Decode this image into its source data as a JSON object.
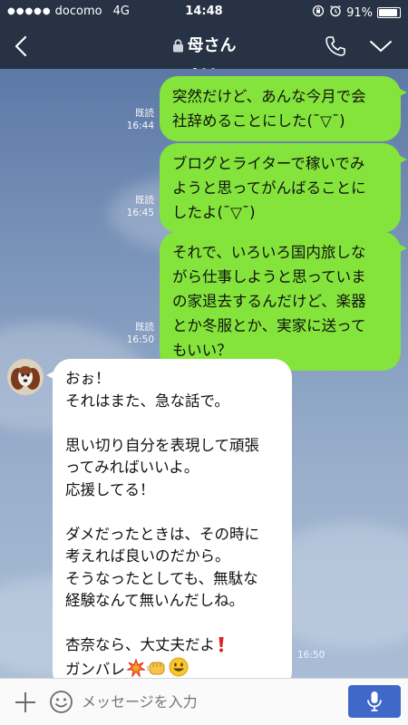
{
  "status_bar": {
    "signal_dots": "●●●●●",
    "carrier": "docomo",
    "network": "4G",
    "time": "14:48",
    "battery_text": "91%",
    "battery_level": 0.91
  },
  "header": {
    "title": "母さん",
    "page_count": 3,
    "active_page": 1
  },
  "messages": [
    {
      "direction": "outgoing",
      "lines": [
        "突然だけど、あんな今月で会",
        "社辞めることにした(¯▽¯)"
      ],
      "read_label": "既読",
      "time": "16:44"
    },
    {
      "direction": "outgoing",
      "lines": [
        "ブログとライターで稼いでみ",
        "ようと思ってがんばることに",
        "したよ(¯▽¯)"
      ],
      "read_label": "既読",
      "time": "16:45"
    },
    {
      "direction": "outgoing",
      "lines": [
        "それで、いろいろ国内旅しな",
        "がら仕事しようと思っていま",
        "の家退去するんだけど、楽器",
        "とか冬服とか、実家に送って",
        "もいい？"
      ],
      "read_label": "既読",
      "time": "16:50"
    },
    {
      "direction": "incoming",
      "paragraphs": [
        "おぉ！\nそれはまた、急な話で。",
        "思い切り自分を表現して頑張\nってみればいいよ。\n応援してる！",
        "ダメだったときは、その時に\n考えれば良いのだから。\nそうなったとしても、無駄な\n経験なんて無いんだしね。",
        "杏奈なら、大丈夫だよ"
      ],
      "last_line": "ガンバレ",
      "emojis": [
        "exclamation-red",
        "collision",
        "fist-bump",
        "smiley-face"
      ],
      "time": "16:50"
    }
  ],
  "input_bar": {
    "placeholder": "メッセージを入力"
  },
  "colors": {
    "header_bg": "#273244",
    "outgoing_bubble": "#84e43b",
    "incoming_bubble": "#ffffff",
    "mic_button": "#3f68c9"
  }
}
